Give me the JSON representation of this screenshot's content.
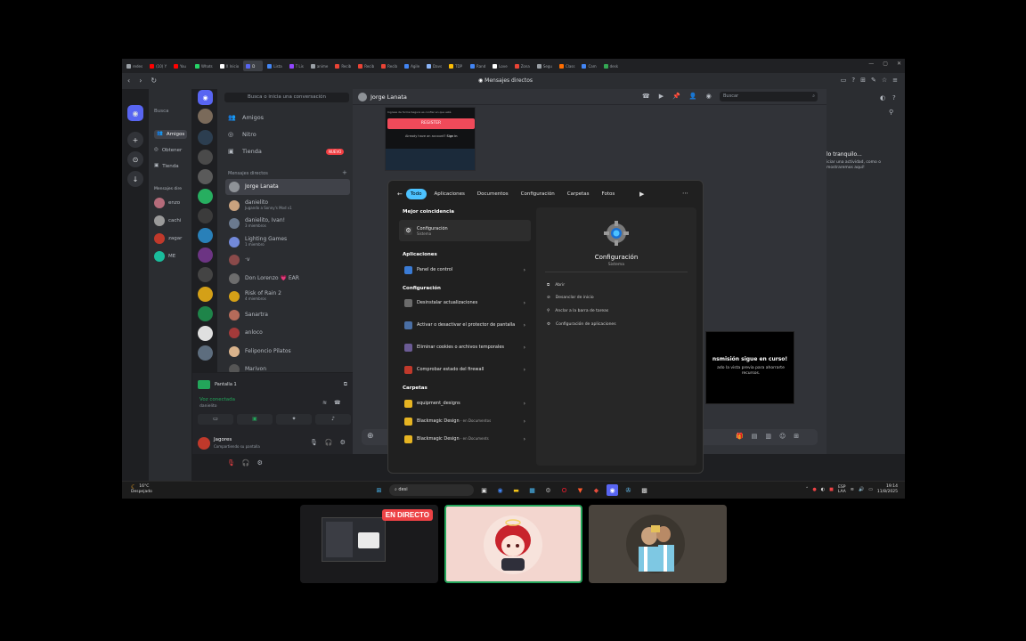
{
  "browser": {
    "tabs": [
      {
        "label": "redes",
        "color": "#9aa0a6"
      },
      {
        "label": "(10) Y",
        "color": "#ff0000"
      },
      {
        "label": "You",
        "color": "#ff0000"
      },
      {
        "label": "Whats",
        "color": "#25d366"
      },
      {
        "label": "X Inicio",
        "color": "#ffffff"
      },
      {
        "label": "D",
        "color": "#5865f2"
      },
      {
        "label": "Lista",
        "color": "#4285f4"
      },
      {
        "label": "T Lis",
        "color": "#9146ff"
      },
      {
        "label": "anime",
        "color": "#9aa0a6"
      },
      {
        "label": "Recib",
        "color": "#ea4335"
      },
      {
        "label": "Recib",
        "color": "#ea4335"
      },
      {
        "label": "Recib",
        "color": "#ea4335"
      },
      {
        "label": "Agile",
        "color": "#4285f4"
      },
      {
        "label": "Davs",
        "color": "#8ab4f8"
      },
      {
        "label": "TDP",
        "color": "#fbbc04"
      },
      {
        "label": "Rand",
        "color": "#4285f4"
      },
      {
        "label": "Love",
        "color": "#ffffff"
      },
      {
        "label": "Zona",
        "color": "#ea4335"
      },
      {
        "label": "Segu",
        "color": "#9aa0a6"
      },
      {
        "label": "Class",
        "color": "#ff6d00"
      },
      {
        "label": "Cam",
        "color": "#4285f4"
      },
      {
        "label": "desk",
        "color": "#34a853"
      }
    ],
    "page_title": "Mensajes directos"
  },
  "discord_main": {
    "nav": [
      {
        "label": "Amigos",
        "icon": "friends-icon"
      },
      {
        "label": "Obtener",
        "icon": "nitro-icon"
      },
      {
        "label": "Tienda",
        "icon": "shop-icon"
      }
    ],
    "dm_header": "Mensajes dire",
    "dms": [
      "enzo",
      "cachi",
      "zagar",
      "ME"
    ],
    "search_short": "Busca",
    "user": {
      "name": "Jorge Lanata",
      "status": "En línea"
    }
  },
  "discord2": {
    "search": "Busca o inicia una conversación",
    "nav": [
      {
        "label": "Amigos",
        "icon": "friends-icon"
      },
      {
        "label": "Nitro",
        "icon": "nitro-icon"
      },
      {
        "label": "Tienda",
        "icon": "shop-icon"
      }
    ],
    "new_badge": "NUEVO",
    "dm_header": "Mensajes directos",
    "dms": [
      {
        "name": "Jorge Lanata",
        "sub": "",
        "color": "#8e9297"
      },
      {
        "name": "danielito",
        "sub": "Jugando a Sonny's Mod v1",
        "color": "#c9a27e"
      },
      {
        "name": "danielito, Ivan!",
        "sub": "3 miembros",
        "color": "#6b7a8f"
      },
      {
        "name": "Lighting Games",
        "sub": "1 miembro",
        "color": "#7289da"
      },
      {
        "name": "·v",
        "sub": "",
        "color": "#8a4a4a"
      },
      {
        "name": "Don Lorenzo 💗 EAR",
        "sub": "",
        "color": "#6d6d6d"
      },
      {
        "name": "Risk of Rain 2",
        "sub": "4 miembros",
        "color": "#d4a017"
      },
      {
        "name": "Sanartra",
        "sub": "",
        "color": "#b56b5a"
      },
      {
        "name": "anloco",
        "sub": "",
        "color": "#a33a3a"
      },
      {
        "name": "Feliponcio Pilatos",
        "sub": "",
        "color": "#d9b38c"
      },
      {
        "name": "Marivon",
        "sub": "",
        "color": "#555555"
      }
    ],
    "voice": {
      "share_label": "Pantalla 1",
      "connected": "Voz conectada",
      "channel": "danielito"
    },
    "user": {
      "name": "Jagores",
      "status": "Compartiendo su pantalla"
    }
  },
  "chat": {
    "recipient": "Jorge Lanata",
    "search_placeholder": "Buscar",
    "preview": {
      "remember": "Ingresa de forma Segura es confiar en que esté",
      "button": "REGISTER",
      "account": "Already have an account?",
      "signin": "Sign in"
    }
  },
  "right_panel": {
    "title": "lo tranquilo...",
    "subtitle": "iciar una actividad, como o mostraremos aquí!"
  },
  "stream_notice": {
    "title": "nsmisión sigue en curso!",
    "text": "ado la vista previa para ahorrarte recursos."
  },
  "start_search": {
    "filters": [
      "Todo",
      "Aplicaciones",
      "Documentos",
      "Configuración",
      "Carpetas",
      "Fotos"
    ],
    "best_match_header": "Mejor coincidencia",
    "best": {
      "label": "Configuración",
      "sub": "Sistema"
    },
    "apps_header": "Aplicaciones",
    "apps": [
      {
        "label": "Panel de control",
        "color": "#3a7bd5"
      }
    ],
    "config_header": "Configuración",
    "config": [
      {
        "label": "Desinstalar actualizaciones",
        "color": "#6b6b6b"
      },
      {
        "label": "Activar o desactivar el protector de pantalla",
        "color": "#4a6fa5"
      },
      {
        "label": "Eliminar cookies o archivos temporales",
        "color": "#6b5b95"
      },
      {
        "label": "Comprobar estado del firewall",
        "color": "#c0392b"
      }
    ],
    "folders_header": "Carpetas",
    "folders": [
      {
        "label": "equipment_designs",
        "sub": ""
      },
      {
        "label": "Blackmagic Design",
        "sub": " - en Documentos"
      },
      {
        "label": "Blackmagic Design",
        "sub": " - en Documents"
      }
    ],
    "detail": {
      "title": "Configuración",
      "sub": "Sistema",
      "actions": [
        "Abrir",
        "Desanclar de inicio",
        "Anclar a la barra de tareas",
        "Configuración de aplicaciones"
      ]
    }
  },
  "taskbar": {
    "weather_temp": "16°C",
    "weather_desc": "Despejado",
    "search_text": "desi",
    "lang": "ESP",
    "lang2": "LAA",
    "time": "19:14",
    "date": "11/8/2025"
  },
  "call": {
    "live_label": "EN DIRECTO",
    "accent": "#23a55a"
  }
}
